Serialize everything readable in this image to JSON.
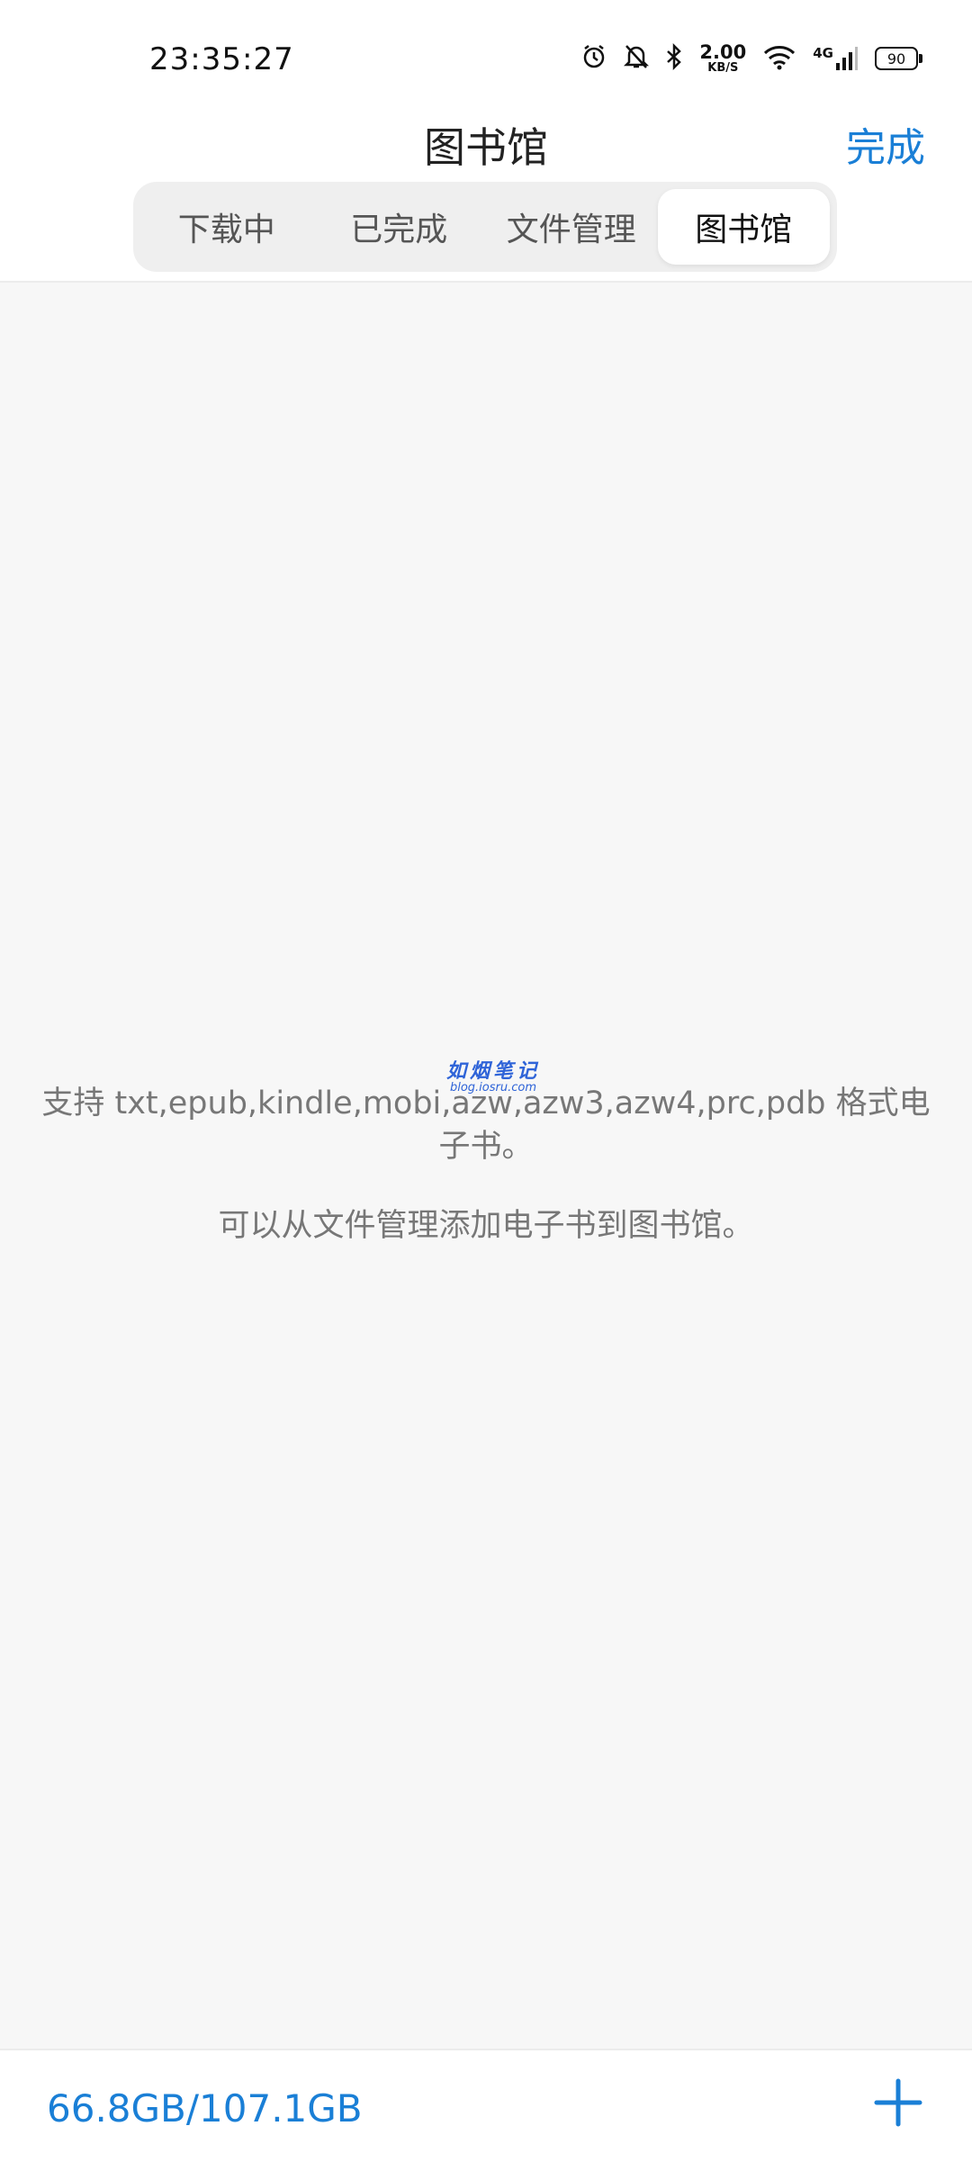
{
  "status_bar": {
    "time": "23:35:27",
    "net_speed_value": "2.00",
    "net_speed_unit": "KB/S",
    "network_type": "4G",
    "battery_level": "90",
    "icons": [
      "alarm-icon",
      "mute-bell-icon",
      "bluetooth-icon",
      "wifi-icon",
      "cellular-signal-icon",
      "battery-icon"
    ]
  },
  "header": {
    "title": "图书馆",
    "done_label": "完成"
  },
  "tabs": [
    {
      "label": "下载中",
      "active": false
    },
    {
      "label": "已完成",
      "active": false
    },
    {
      "label": "文件管理",
      "active": false
    },
    {
      "label": "图书馆",
      "active": true
    }
  ],
  "empty_state": {
    "supported_formats": "支持 txt,epub,kindle,mobi,azw,azw3,azw4,prc,pdb 格式电子书。",
    "hint": "可以从文件管理添加电子书到图书馆。"
  },
  "watermark": {
    "title": "如烟笔记",
    "subtitle": "blog.iosru.com"
  },
  "footer": {
    "storage": "66.8GB/107.1GB",
    "add_icon": "plus-icon"
  },
  "colors": {
    "accent": "#1a7fd6",
    "background": "#f7f7f7",
    "watermark": "#2f64d8"
  }
}
